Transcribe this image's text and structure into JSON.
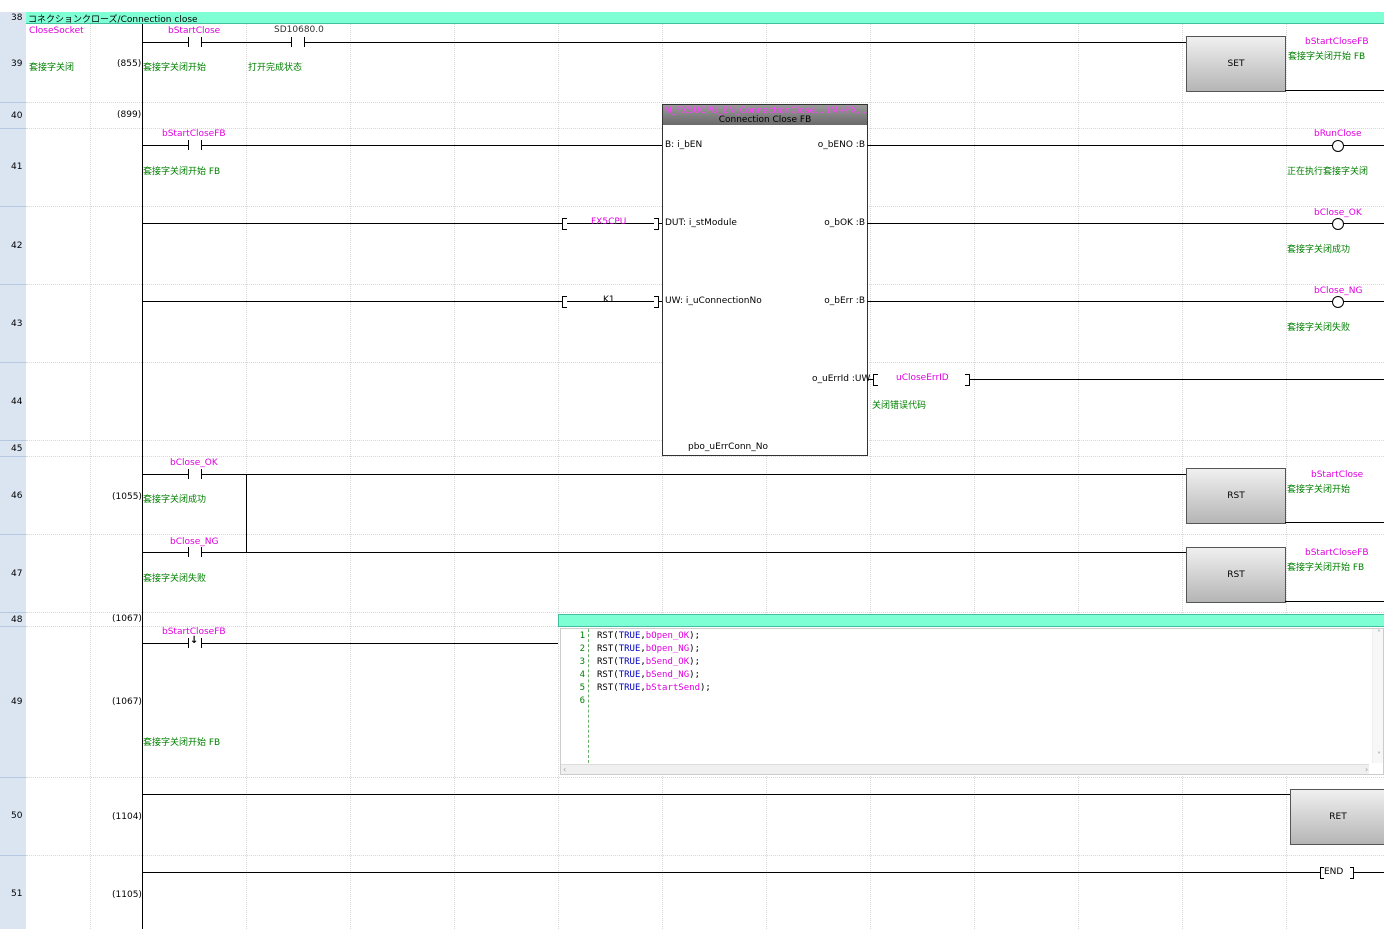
{
  "comment_row": {
    "row_no": "38",
    "text": "コネクションクローズ/Connection close"
  },
  "rows": [
    {
      "no": "39",
      "step": "(855)"
    },
    {
      "no": "40",
      "step": "(899)"
    },
    {
      "no": "41",
      "step": ""
    },
    {
      "no": "42",
      "step": ""
    },
    {
      "no": "43",
      "step": ""
    },
    {
      "no": "44",
      "step": ""
    },
    {
      "no": "45",
      "step": ""
    },
    {
      "no": "46",
      "step": "(1055)"
    },
    {
      "no": "47",
      "step": ""
    },
    {
      "no": "48",
      "step": "(1067)"
    },
    {
      "no": "49",
      "step": "(1067)"
    },
    {
      "no": "50",
      "step": "(1104)"
    },
    {
      "no": "51",
      "step": "(1105)"
    }
  ],
  "statement": {
    "label": "CloseSocket",
    "comment": "套接字关闭"
  },
  "rung39": {
    "contact1": {
      "name": "bStartClose",
      "comment": "套接字关闭开始"
    },
    "contact2": {
      "name": "SD10680.0",
      "comment": "打开完成状态"
    },
    "coil": {
      "instr": "SET",
      "name": "bStartCloseFB",
      "comment": "套接字关闭开始 FB"
    }
  },
  "fb": {
    "instance": "M_FX5UCPU_EN_ConnectionClose… (M+FX…",
    "title": "Connection Close FB",
    "in_en": "B: i_bEN",
    "in_dut": "DUT: i_stModule",
    "in_uw": "UW: i_uConnectionNo",
    "out_eno": "o_bENO :B",
    "out_ok": "o_bOK :B",
    "out_err": "o_bErr :B",
    "out_errid": "o_uErrId :UW",
    "footer": "pbo_uErrConn_No",
    "arg_module": "FX5CPU",
    "arg_conn": "K1"
  },
  "rung41": {
    "contact": {
      "name": "bStartCloseFB",
      "comment": "套接字关闭开始 FB"
    },
    "coil_run": {
      "name": "bRunClose",
      "comment": "正在执行套接字关闭"
    },
    "coil_ok": {
      "name": "bClose_OK",
      "comment": "套接字关闭成功"
    },
    "coil_ng": {
      "name": "bClose_NG",
      "comment": "套接字关闭失败"
    },
    "errid": {
      "name": "uCloseErrID",
      "comment": "关闭错误代码"
    }
  },
  "rung46": {
    "contact_ok": {
      "name": "bClose_OK",
      "comment": "套接字关闭成功"
    },
    "contact_ng": {
      "name": "bClose_NG",
      "comment": "套接字关闭失败"
    },
    "coil1": {
      "instr": "RST",
      "name": "bStartClose",
      "comment": "套接字关闭开始"
    },
    "coil2": {
      "instr": "RST",
      "name": "bStartCloseFB",
      "comment": "套接字关闭开始 FB"
    }
  },
  "rung49": {
    "contact": {
      "name": "bStartCloseFB",
      "comment": "套接字关闭开始 FB"
    },
    "code_lines": [
      {
        "n": "1",
        "kw": "RST",
        "arg": "TRUE",
        "var": "bOpen_OK"
      },
      {
        "n": "2",
        "kw": "RST",
        "arg": "TRUE",
        "var": "bOpen_NG"
      },
      {
        "n": "3",
        "kw": "RST",
        "arg": "TRUE",
        "var": "bSend_OK"
      },
      {
        "n": "4",
        "kw": "RST",
        "arg": "TRUE",
        "var": "bSend_NG"
      },
      {
        "n": "5",
        "kw": "RST",
        "arg": "TRUE",
        "var": "bStartSend"
      },
      {
        "n": "6",
        "kw": "",
        "arg": "",
        "var": ""
      }
    ]
  },
  "rung50": {
    "instr": "RET"
  },
  "rung51": {
    "instr": "END"
  },
  "colors": {
    "comment_bar": "#7fffd4",
    "row_header": "#dbe5f1",
    "device_label": "#e000e0",
    "comment_text": "#008000"
  }
}
